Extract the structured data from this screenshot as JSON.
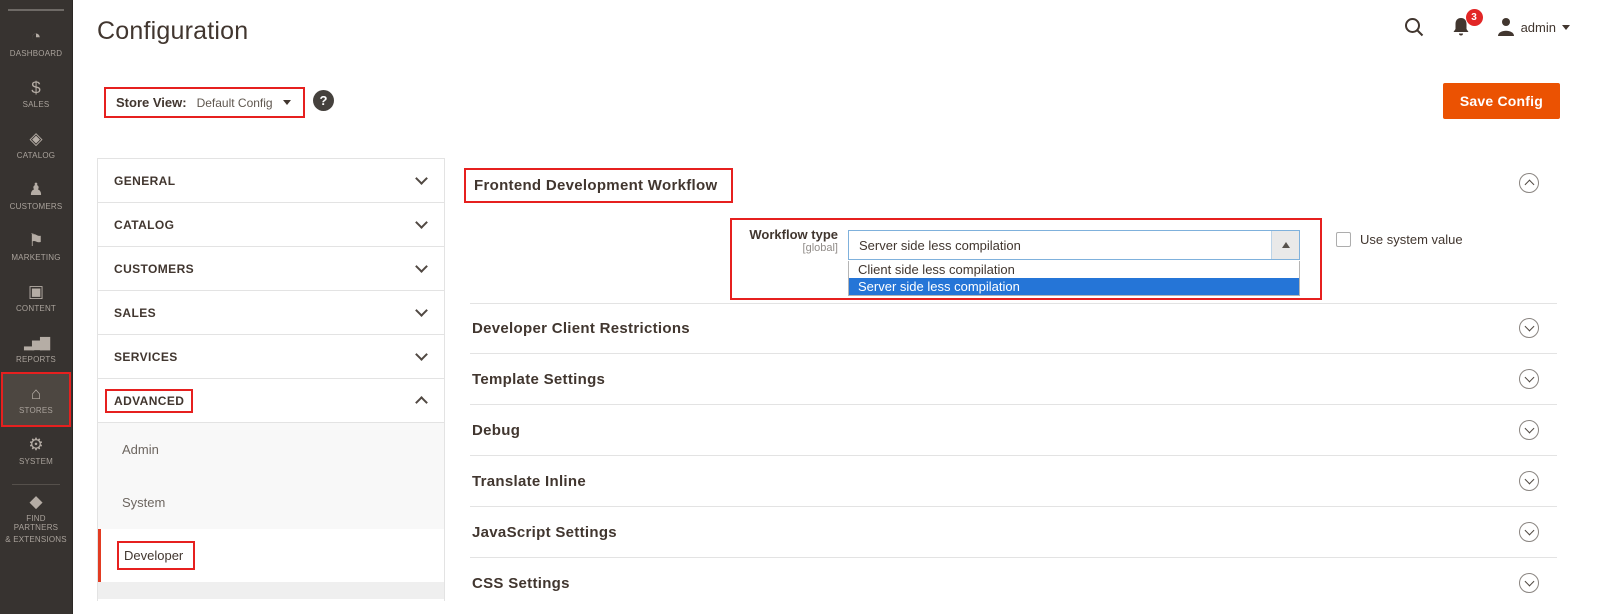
{
  "colors": {
    "sidebar_bg": "#373330",
    "sidebar_selected_bg": "#4d4741",
    "accent_orange": "#eb5202",
    "annotation_red": "#e6201f",
    "badge_red": "#e22626",
    "option_highlight_blue": "#2575d7",
    "active_item_bar": "#e23b22",
    "divider_gray": "#e3e3e3"
  },
  "sidebar": {
    "items": [
      {
        "label": "DASHBOARD",
        "icon": "dashboard-icon",
        "glyph": "◔"
      },
      {
        "label": "SALES",
        "icon": "sales-icon",
        "glyph": "$"
      },
      {
        "label": "CATALOG",
        "icon": "catalog-icon",
        "glyph": "◈"
      },
      {
        "label": "CUSTOMERS",
        "icon": "customers-icon",
        "glyph": "♟"
      },
      {
        "label": "MARKETING",
        "icon": "marketing-icon",
        "glyph": "⚑"
      },
      {
        "label": "CONTENT",
        "icon": "content-icon",
        "glyph": "▣"
      },
      {
        "label": "REPORTS",
        "icon": "reports-icon",
        "glyph": "▂▅▇"
      },
      {
        "label": "STORES",
        "icon": "stores-icon",
        "glyph": "⌂"
      },
      {
        "label": "SYSTEM",
        "icon": "system-icon",
        "glyph": "⚙"
      },
      {
        "label_line1": "FIND PARTNERS",
        "label_line2": "& EXTENSIONS",
        "icon": "extensions-icon",
        "glyph": "◆"
      }
    ]
  },
  "header": {
    "title": "Configuration",
    "notification_count": "3",
    "user_name": "admin"
  },
  "toolbar": {
    "store_view_label": "Store View:",
    "store_view_value": "Default Config",
    "help_glyph": "?",
    "save_label": "Save Config"
  },
  "config_nav": {
    "sections": [
      {
        "label": "GENERAL"
      },
      {
        "label": "CATALOG"
      },
      {
        "label": "CUSTOMERS"
      },
      {
        "label": "SALES"
      },
      {
        "label": "SERVICES"
      },
      {
        "label": "ADVANCED"
      }
    ],
    "advanced_children": [
      {
        "label": "Admin"
      },
      {
        "label": "System"
      },
      {
        "label": "Developer"
      }
    ]
  },
  "main": {
    "section_title": "Frontend Development Workflow",
    "workflow": {
      "label": "Workflow type",
      "scope": "[global]",
      "value": "Server side less compilation",
      "options": [
        "Client side less compilation",
        "Server side less compilation"
      ],
      "use_system_value_label": "Use system value"
    },
    "collapsed_sections": [
      {
        "label": "Developer Client Restrictions"
      },
      {
        "label": "Template Settings"
      },
      {
        "label": "Debug"
      },
      {
        "label": "Translate Inline"
      },
      {
        "label": "JavaScript Settings"
      },
      {
        "label": "CSS Settings"
      }
    ]
  }
}
